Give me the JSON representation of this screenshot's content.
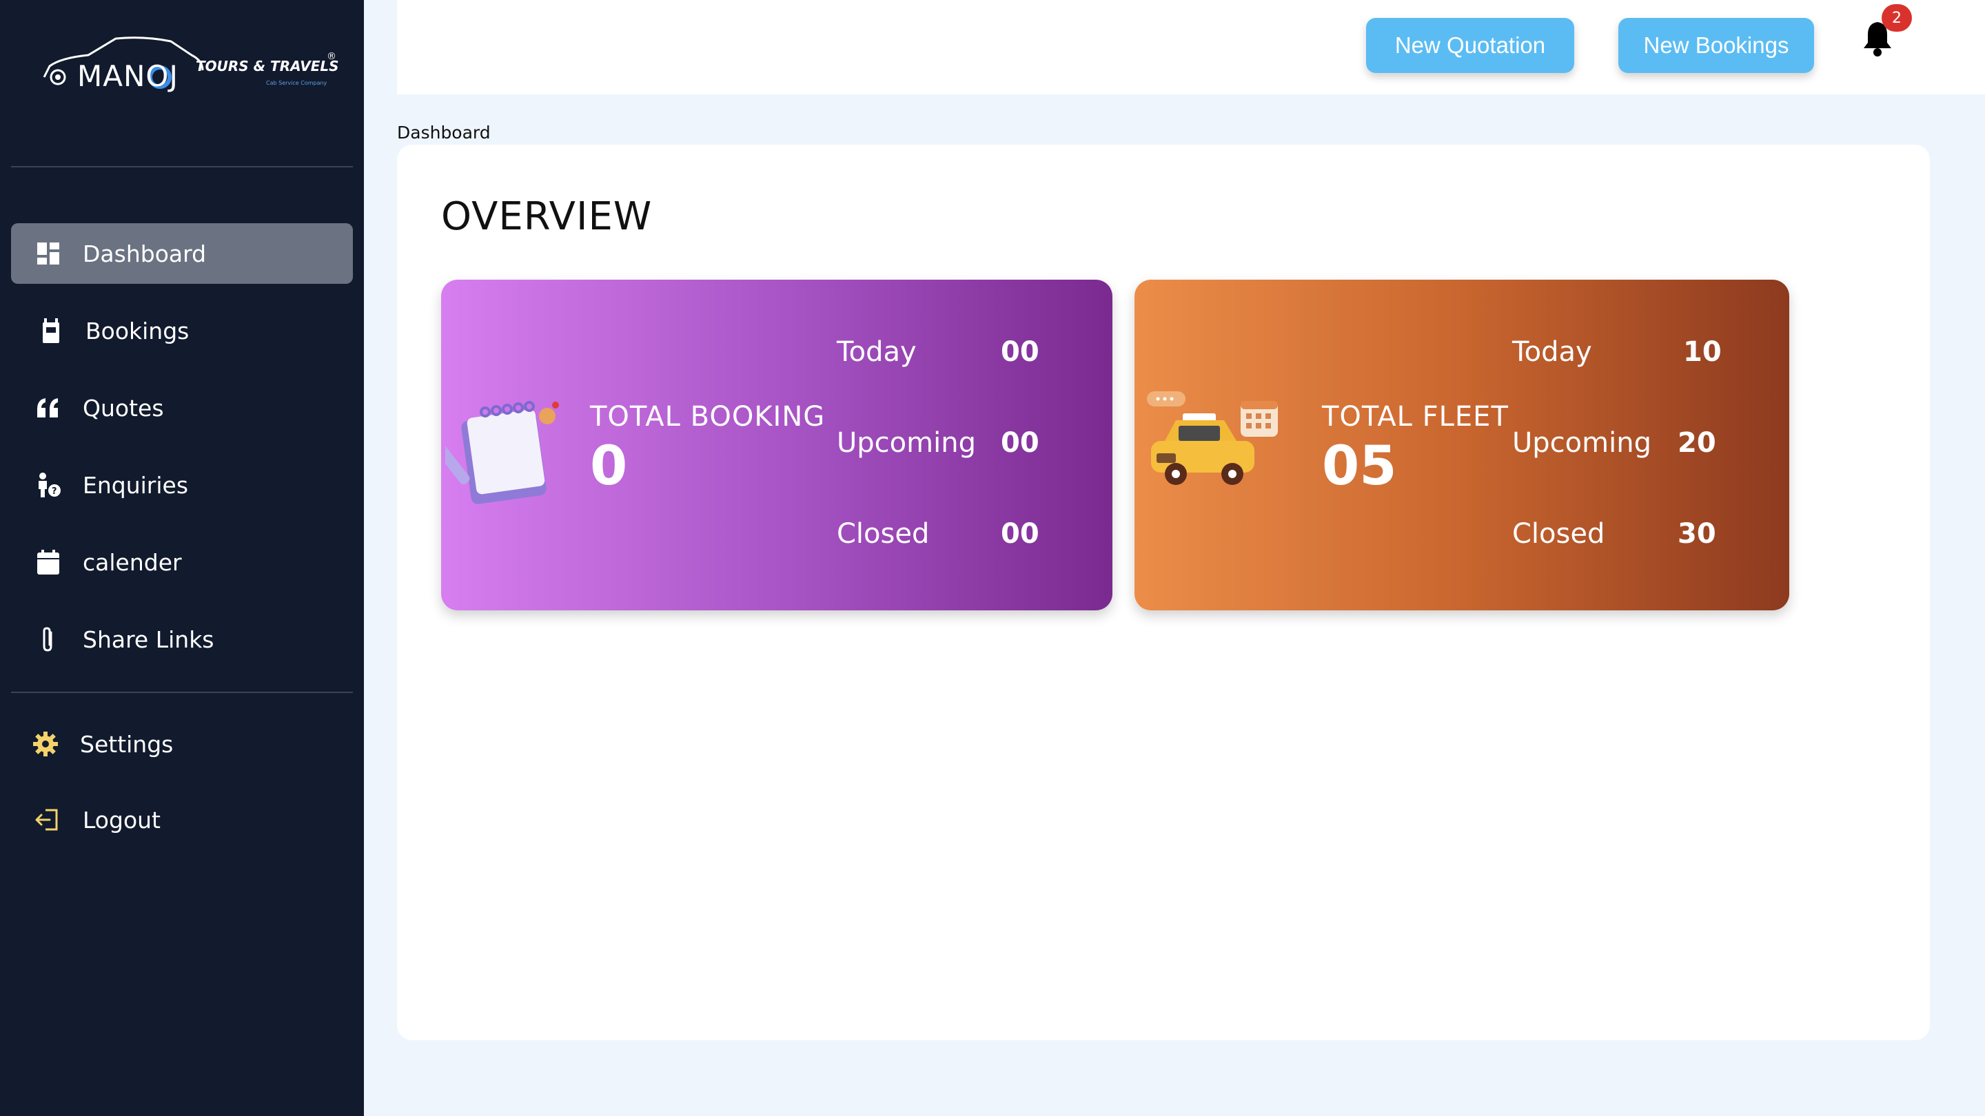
{
  "brand": {
    "name": "MANOJ",
    "tagline": "TOURS & TRAVELS",
    "sub": "Cab Service Company",
    "registered": "®"
  },
  "sidebar": {
    "items": [
      {
        "label": "Dashboard",
        "icon": "dashboard-icon",
        "active": true
      },
      {
        "label": "Bookings",
        "icon": "bookings-icon"
      },
      {
        "label": "Quotes",
        "icon": "quote-icon"
      },
      {
        "label": "Enquiries",
        "icon": "enquiry-icon"
      },
      {
        "label": "calender",
        "icon": "calendar-icon"
      },
      {
        "label": "Share Links",
        "icon": "paperclip-icon"
      }
    ],
    "bottom_items": [
      {
        "label": "Settings",
        "icon": "gear-icon"
      },
      {
        "label": "Logout",
        "icon": "logout-icon"
      }
    ]
  },
  "header": {
    "new_quotation": "New Quotation",
    "new_bookings": "New Bookings",
    "notification_count": "2"
  },
  "breadcrumb": "Dashboard",
  "main": {
    "title": "OVERVIEW",
    "cards": [
      {
        "label": "TOTAL BOOKING",
        "total": "0",
        "stats": [
          {
            "label": "Today",
            "value": "00"
          },
          {
            "label": "Upcoming",
            "value": "00"
          },
          {
            "label": "Closed",
            "value": "00"
          }
        ]
      },
      {
        "label": "TOTAL FLEET",
        "total": "05",
        "stats": [
          {
            "label": "Today",
            "value": "10"
          },
          {
            "label": "Upcoming",
            "value": "20"
          },
          {
            "label": "Closed",
            "value": "30"
          }
        ]
      }
    ]
  },
  "colors": {
    "sidebar_bg": "#121a2d",
    "active_item": "#6b7282",
    "button_bg": "#5bbcf3",
    "badge": "#d9322d",
    "booking_card": "#a451c2",
    "fleet_card": "#c9662f",
    "settings_icon": "#f3d36a"
  }
}
